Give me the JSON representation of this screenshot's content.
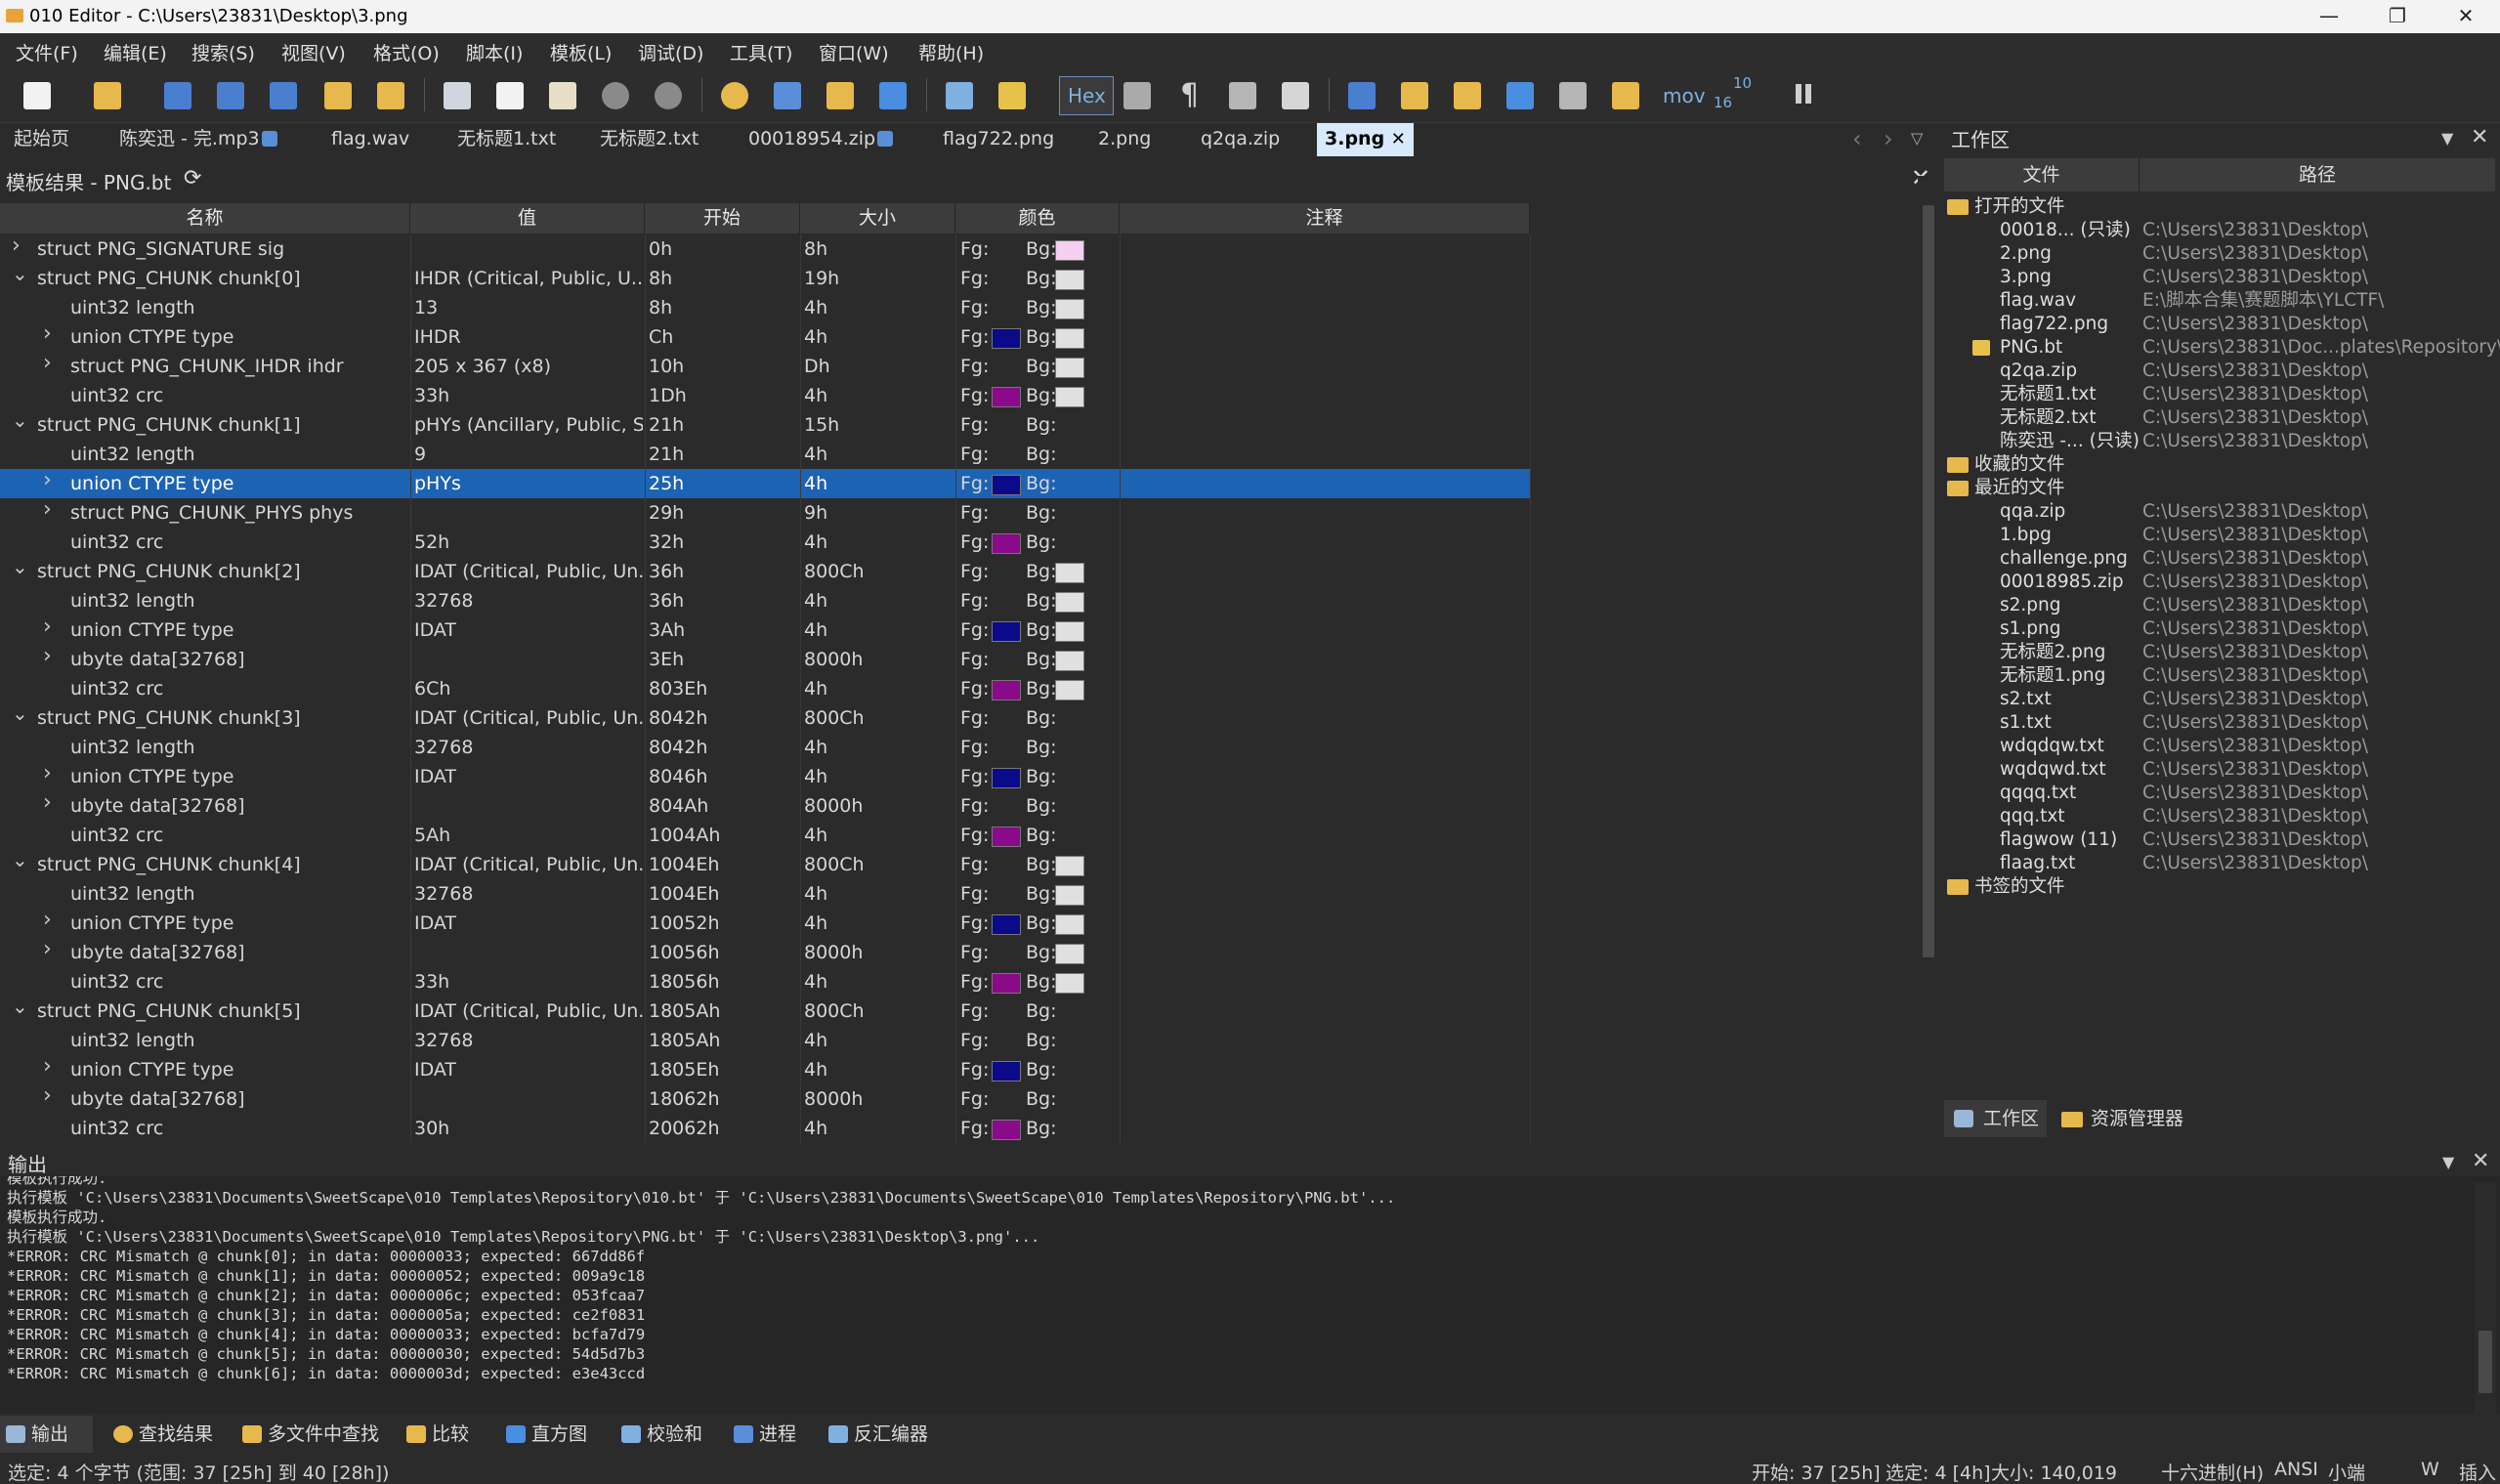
{
  "window": {
    "title": "010 Editor - C:\\Users\\23831\\Desktop\\3.png",
    "minimize_glyph": "—",
    "maximize_glyph": "❐",
    "close_glyph": "✕"
  },
  "menu": [
    "文件(F)",
    "编辑(E)",
    "搜索(S)",
    "视图(V)",
    "格式(O)",
    "脚本(I)",
    "模板(L)",
    "调试(D)",
    "工具(T)",
    "窗口(W)",
    "帮助(H)"
  ],
  "toolbar": {
    "hex_label": "Hex",
    "mov_label": "mov",
    "base_label_top": "10",
    "base_label_bottom": "16"
  },
  "tabs": [
    "起始页",
    "陈奕迅 - 完.mp3",
    "flag.wav",
    "无标题1.txt",
    "无标题2.txt",
    "00018954.zip",
    "flag722.png",
    "2.png",
    "q2qa.zip",
    "3.png"
  ],
  "active_tab": "3.png",
  "tab_nav": {
    "prev": "‹",
    "next": "›",
    "list": "▽"
  },
  "template_panel": {
    "title": "模板结果 - PNG.bt",
    "columns": [
      "名称",
      "值",
      "开始",
      "大小",
      "颜色",
      "注释"
    ],
    "fg_label": "Fg:",
    "bg_label": "Bg:",
    "rows": [
      {
        "name": "struct PNG_SIGNATURE sig",
        "level": 0,
        "exp": "collapsed",
        "value": "",
        "start": "0h",
        "size": "8h",
        "fg": "",
        "bg": "#f5d0f0"
      },
      {
        "name": "struct PNG_CHUNK chunk[0]",
        "level": 0,
        "exp": "expanded",
        "value": "IHDR  (Critical, Public, U...",
        "start": "8h",
        "size": "19h",
        "fg": "",
        "bg": "#e0e0e0"
      },
      {
        "name": "uint32 length",
        "level": 1,
        "exp": "none",
        "value": "13",
        "start": "8h",
        "size": "4h",
        "fg": "",
        "bg": "#e0e0e0"
      },
      {
        "name": "union CTYPE type",
        "level": 1,
        "exp": "collapsed",
        "value": "IHDR",
        "start": "Ch",
        "size": "4h",
        "fg": "#0a0a8a",
        "bg": "#e0e0e0"
      },
      {
        "name": "struct PNG_CHUNK_IHDR ihdr",
        "level": 1,
        "exp": "collapsed",
        "value": "205 x 367 (x8)",
        "start": "10h",
        "size": "Dh",
        "fg": "",
        "bg": "#e0e0e0"
      },
      {
        "name": "uint32 crc",
        "level": 1,
        "exp": "none",
        "value": "33h",
        "start": "1Dh",
        "size": "4h",
        "fg": "#8a0a8a",
        "bg": "#e0e0e0"
      },
      {
        "name": "struct PNG_CHUNK chunk[1]",
        "level": 0,
        "exp": "expanded",
        "value": "pHYs  (Ancillary, Public, S...",
        "start": "21h",
        "size": "15h",
        "fg": "",
        "bg": ""
      },
      {
        "name": "uint32 length",
        "level": 1,
        "exp": "none",
        "value": "9",
        "start": "21h",
        "size": "4h",
        "fg": "",
        "bg": ""
      },
      {
        "name": "union CTYPE type",
        "level": 1,
        "exp": "collapsed",
        "value": "pHYs",
        "start": "25h",
        "size": "4h",
        "fg": "#0a0a8a",
        "bg": "",
        "selected": true
      },
      {
        "name": "struct PNG_CHUNK_PHYS phys",
        "level": 1,
        "exp": "collapsed",
        "value": "",
        "start": "29h",
        "size": "9h",
        "fg": "",
        "bg": ""
      },
      {
        "name": "uint32 crc",
        "level": 1,
        "exp": "none",
        "value": "52h",
        "start": "32h",
        "size": "4h",
        "fg": "#8a0a8a",
        "bg": ""
      },
      {
        "name": "struct PNG_CHUNK chunk[2]",
        "level": 0,
        "exp": "expanded",
        "value": "IDAT  (Critical, Public, Un...",
        "start": "36h",
        "size": "800Ch",
        "fg": "",
        "bg": "#e0e0e0"
      },
      {
        "name": "uint32 length",
        "level": 1,
        "exp": "none",
        "value": "32768",
        "start": "36h",
        "size": "4h",
        "fg": "",
        "bg": "#e0e0e0"
      },
      {
        "name": "union CTYPE type",
        "level": 1,
        "exp": "collapsed",
        "value": "IDAT",
        "start": "3Ah",
        "size": "4h",
        "fg": "#0a0a8a",
        "bg": "#e0e0e0"
      },
      {
        "name": "ubyte data[32768]",
        "level": 1,
        "exp": "collapsed",
        "value": "",
        "start": "3Eh",
        "size": "8000h",
        "fg": "",
        "bg": "#e0e0e0"
      },
      {
        "name": "uint32 crc",
        "level": 1,
        "exp": "none",
        "value": "6Ch",
        "start": "803Eh",
        "size": "4h",
        "fg": "#8a0a8a",
        "bg": "#e0e0e0"
      },
      {
        "name": "struct PNG_CHUNK chunk[3]",
        "level": 0,
        "exp": "expanded",
        "value": "IDAT  (Critical, Public, Un...",
        "start": "8042h",
        "size": "800Ch",
        "fg": "",
        "bg": ""
      },
      {
        "name": "uint32 length",
        "level": 1,
        "exp": "none",
        "value": "32768",
        "start": "8042h",
        "size": "4h",
        "fg": "",
        "bg": ""
      },
      {
        "name": "union CTYPE type",
        "level": 1,
        "exp": "collapsed",
        "value": "IDAT",
        "start": "8046h",
        "size": "4h",
        "fg": "#0a0a8a",
        "bg": ""
      },
      {
        "name": "ubyte data[32768]",
        "level": 1,
        "exp": "collapsed",
        "value": "",
        "start": "804Ah",
        "size": "8000h",
        "fg": "",
        "bg": ""
      },
      {
        "name": "uint32 crc",
        "level": 1,
        "exp": "none",
        "value": "5Ah",
        "start": "1004Ah",
        "size": "4h",
        "fg": "#8a0a8a",
        "bg": ""
      },
      {
        "name": "struct PNG_CHUNK chunk[4]",
        "level": 0,
        "exp": "expanded",
        "value": "IDAT  (Critical, Public, Un...",
        "start": "1004Eh",
        "size": "800Ch",
        "fg": "",
        "bg": "#e0e0e0"
      },
      {
        "name": "uint32 length",
        "level": 1,
        "exp": "none",
        "value": "32768",
        "start": "1004Eh",
        "size": "4h",
        "fg": "",
        "bg": "#e0e0e0"
      },
      {
        "name": "union CTYPE type",
        "level": 1,
        "exp": "collapsed",
        "value": "IDAT",
        "start": "10052h",
        "size": "4h",
        "fg": "#0a0a8a",
        "bg": "#e0e0e0"
      },
      {
        "name": "ubyte data[32768]",
        "level": 1,
        "exp": "collapsed",
        "value": "",
        "start": "10056h",
        "size": "8000h",
        "fg": "",
        "bg": "#e0e0e0"
      },
      {
        "name": "uint32 crc",
        "level": 1,
        "exp": "none",
        "value": "33h",
        "start": "18056h",
        "size": "4h",
        "fg": "#8a0a8a",
        "bg": "#e0e0e0"
      },
      {
        "name": "struct PNG_CHUNK chunk[5]",
        "level": 0,
        "exp": "expanded",
        "value": "IDAT  (Critical, Public, Un...",
        "start": "1805Ah",
        "size": "800Ch",
        "fg": "",
        "bg": ""
      },
      {
        "name": "uint32 length",
        "level": 1,
        "exp": "none",
        "value": "32768",
        "start": "1805Ah",
        "size": "4h",
        "fg": "",
        "bg": ""
      },
      {
        "name": "union CTYPE type",
        "level": 1,
        "exp": "collapsed",
        "value": "IDAT",
        "start": "1805Eh",
        "size": "4h",
        "fg": "#0a0a8a",
        "bg": ""
      },
      {
        "name": "ubyte data[32768]",
        "level": 1,
        "exp": "collapsed",
        "value": "",
        "start": "18062h",
        "size": "8000h",
        "fg": "",
        "bg": ""
      },
      {
        "name": "uint32 crc",
        "level": 1,
        "exp": "none",
        "value": "30h",
        "start": "20062h",
        "size": "4h",
        "fg": "#8a0a8a",
        "bg": ""
      }
    ]
  },
  "workspace": {
    "title": "工作区",
    "columns": [
      "文件",
      "路径"
    ],
    "open_files_label": "打开的文件",
    "open_files": [
      {
        "file": "00018... (只读)",
        "path": "C:\\Users\\23831\\Desktop\\"
      },
      {
        "file": "2.png",
        "path": "C:\\Users\\23831\\Desktop\\"
      },
      {
        "file": "3.png",
        "path": "C:\\Users\\23831\\Desktop\\"
      },
      {
        "file": "flag.wav",
        "path": "E:\\脚本合集\\赛题脚本\\YLCTF\\"
      },
      {
        "file": "flag722.png",
        "path": "C:\\Users\\23831\\Desktop\\"
      },
      {
        "file": "PNG.bt",
        "path": "C:\\Users\\23831\\Doc...plates\\Repository\\",
        "template": true
      },
      {
        "file": "q2qa.zip",
        "path": "C:\\Users\\23831\\Desktop\\"
      },
      {
        "file": "无标题1.txt",
        "path": "C:\\Users\\23831\\Desktop\\"
      },
      {
        "file": "无标题2.txt",
        "path": "C:\\Users\\23831\\Desktop\\"
      },
      {
        "file": "陈奕迅 -... (只读)",
        "path": "C:\\Users\\23831\\Desktop\\"
      }
    ],
    "favorites_label": "收藏的文件",
    "recent_label": "最近的文件",
    "recent_files": [
      {
        "file": "qqa.zip",
        "path": "C:\\Users\\23831\\Desktop\\"
      },
      {
        "file": "1.bpg",
        "path": "C:\\Users\\23831\\Desktop\\"
      },
      {
        "file": "challenge.png",
        "path": "C:\\Users\\23831\\Desktop\\"
      },
      {
        "file": "00018985.zip",
        "path": "C:\\Users\\23831\\Desktop\\"
      },
      {
        "file": "s2.png",
        "path": "C:\\Users\\23831\\Desktop\\"
      },
      {
        "file": "s1.png",
        "path": "C:\\Users\\23831\\Desktop\\"
      },
      {
        "file": "无标题2.png",
        "path": "C:\\Users\\23831\\Desktop\\"
      },
      {
        "file": "无标题1.png",
        "path": "C:\\Users\\23831\\Desktop\\"
      },
      {
        "file": "s2.txt",
        "path": "C:\\Users\\23831\\Desktop\\"
      },
      {
        "file": "s1.txt",
        "path": "C:\\Users\\23831\\Desktop\\"
      },
      {
        "file": "wdqdqw.txt",
        "path": "C:\\Users\\23831\\Desktop\\"
      },
      {
        "file": "wqdqwd.txt",
        "path": "C:\\Users\\23831\\Desktop\\"
      },
      {
        "file": "qqqq.txt",
        "path": "C:\\Users\\23831\\Desktop\\"
      },
      {
        "file": "qqq.txt",
        "path": "C:\\Users\\23831\\Desktop\\"
      },
      {
        "file": "flagwow (11)",
        "path": "C:\\Users\\23831\\Desktop\\"
      },
      {
        "file": "flaag.txt",
        "path": "C:\\Users\\23831\\Desktop\\"
      }
    ],
    "bookmarks_label": "书签的文件",
    "bottom_tabs": [
      "工作区",
      "资源管理器"
    ]
  },
  "output": {
    "title": "输出",
    "lines": [
      "模板执行成功.",
      "执行模板 'C:\\Users\\23831\\Documents\\SweetScape\\010 Templates\\Repository\\010.bt' 于 'C:\\Users\\23831\\Documents\\SweetScape\\010 Templates\\Repository\\PNG.bt'...",
      "模板执行成功.",
      "执行模板 'C:\\Users\\23831\\Documents\\SweetScape\\010 Templates\\Repository\\PNG.bt' 于 'C:\\Users\\23831\\Desktop\\3.png'...",
      "*ERROR: CRC Mismatch @ chunk[0]; in data: 00000033; expected: 667dd86f",
      "*ERROR: CRC Mismatch @ chunk[1]; in data: 00000052; expected: 009a9c18",
      "*ERROR: CRC Mismatch @ chunk[2]; in data: 0000006c; expected: 053fcaa7",
      "*ERROR: CRC Mismatch @ chunk[3]; in data: 0000005a; expected: ce2f0831",
      "*ERROR: CRC Mismatch @ chunk[4]; in data: 00000033; expected: bcfa7d79",
      "*ERROR: CRC Mismatch @ chunk[5]; in data: 00000030; expected: 54d5d7b3",
      "*ERROR: CRC Mismatch @ chunk[6]; in data: 0000003d; expected: e3e43ccd"
    ]
  },
  "bottom_tabs": [
    "输出",
    "查找结果",
    "多文件中查找",
    "比较",
    "直方图",
    "校验和",
    "进程",
    "反汇编器"
  ],
  "status": {
    "selection": "选定: 4 个字节 (范围: 37 [25h] 到 40 [28h])",
    "start": "开始: 37 [25h]",
    "sel": "选定: 4 [4h]",
    "size": "大小: 140,019",
    "mode": "十六进制(H)",
    "encoding": "ANSI",
    "endian": "小端",
    "w": "W",
    "insert": "插入"
  }
}
